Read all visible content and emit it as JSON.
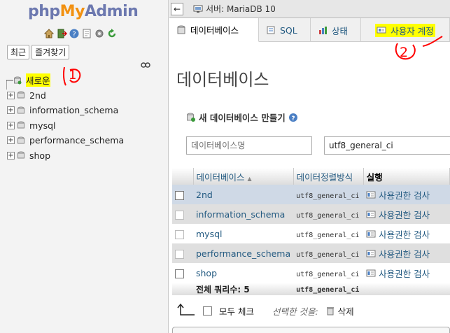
{
  "logo": {
    "php": "php",
    "my": "My",
    "admin": "Admin"
  },
  "nav_buttons": {
    "recent": "최근",
    "favorites": "즐겨찾기"
  },
  "tree": {
    "new_label": "새로운",
    "databases": [
      "2nd",
      "information_schema",
      "mysql",
      "performance_schema",
      "shop"
    ]
  },
  "topbar": {
    "server_label": "서버: MariaDB 10"
  },
  "tabs": [
    {
      "label": "데이터베이스"
    },
    {
      "label": "SQL"
    },
    {
      "label": "상태"
    },
    {
      "label": "사용자 계정"
    }
  ],
  "page": {
    "title": "데이터베이스",
    "create_label": "새 데이터베이스 만들기",
    "dbname_placeholder": "데이터베이스명",
    "collation_value": "utf8_general_ci"
  },
  "table": {
    "headers": {
      "database": "데이터베이스",
      "sort_mark": "▲",
      "collation": "데이터정렬방식",
      "action": "실행"
    },
    "rows": [
      {
        "name": "2nd",
        "collation": "utf8_general_ci",
        "action": "사용권한 검사"
      },
      {
        "name": "information_schema",
        "collation": "utf8_general_ci",
        "action": "사용권한 검사"
      },
      {
        "name": "mysql",
        "collation": "utf8_general_ci",
        "action": "사용권한 검사"
      },
      {
        "name": "performance_schema",
        "collation": "utf8_general_ci",
        "action": "사용권한 검사"
      },
      {
        "name": "shop",
        "collation": "utf8_general_ci",
        "action": "사용권한 검사"
      }
    ],
    "total_label": "전체 쿼리수: 5",
    "total_collation": "utf8_general_ci"
  },
  "bottom": {
    "check_all": "모두 체크",
    "with_selected": "선택한 것을:",
    "delete": "삭제"
  },
  "annotations": {
    "one": "1",
    "two": "2"
  },
  "colors": {
    "accent": "#235a81",
    "highlight": "#ffff00",
    "annotation": "#ff0000"
  }
}
